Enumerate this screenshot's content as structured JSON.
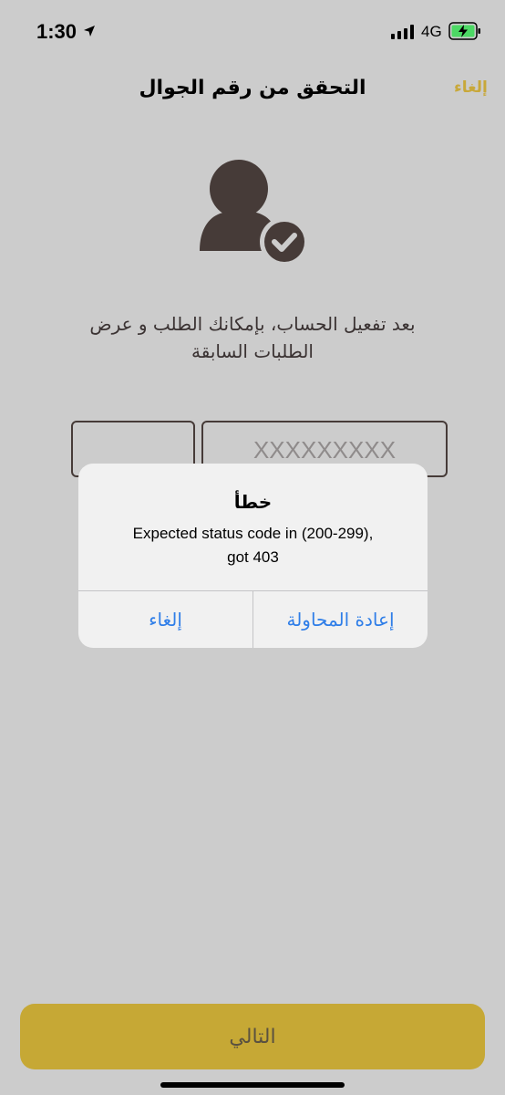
{
  "status_bar": {
    "time": "1:30",
    "network": "4G",
    "icons": [
      "location-arrow-icon",
      "signal-bars-icon",
      "battery-charging-icon"
    ]
  },
  "nav": {
    "title": "التحقق من رقم الجوال",
    "cancel_label": "إلغاء"
  },
  "main": {
    "icon": "user-verified-icon",
    "description_line1": "بعد تفعيل الحساب، بإمكانك الطلب و عرض",
    "description_line2": "الطلبات السابقة",
    "phone_placeholder": "XXXXXXXXX"
  },
  "alert": {
    "title": "خطأ",
    "message_line1": "Expected status code in (200-299),",
    "message_line2": "got 403",
    "cancel_label": "إلغاء",
    "retry_label": "إعادة المحاولة"
  },
  "footer": {
    "next_label": "التالي"
  },
  "colors": {
    "background": "#cccccc",
    "accent_gold": "#c6a835",
    "link_blue": "#2f7ee8",
    "text_dark": "#3b3333"
  }
}
